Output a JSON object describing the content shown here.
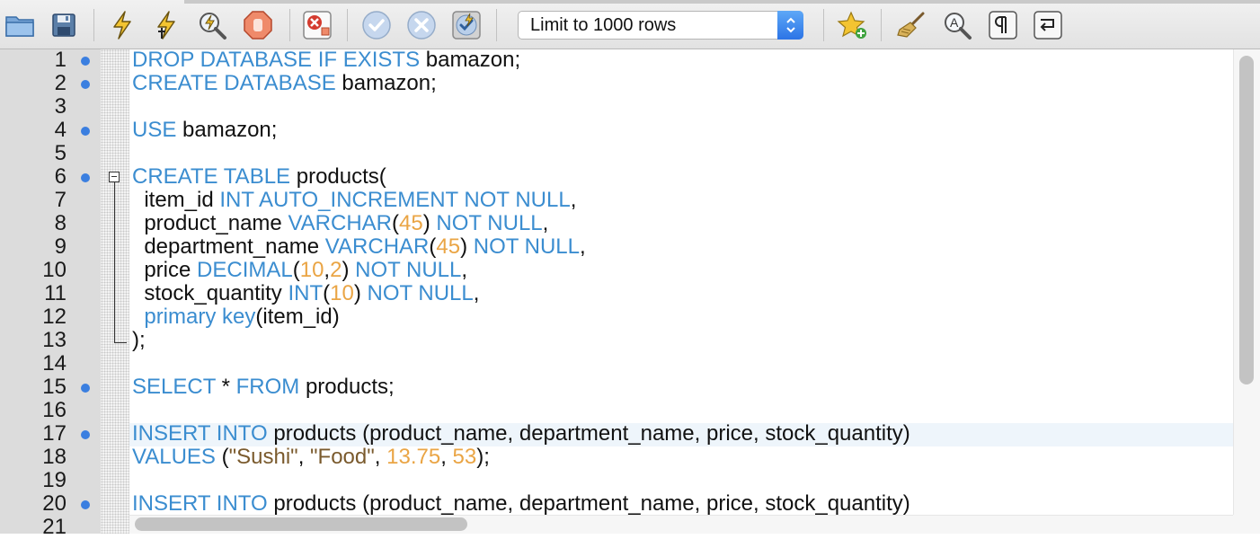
{
  "toolbar": {
    "buttons": [
      {
        "name": "open-folder",
        "icon": "folder-icon"
      },
      {
        "name": "save",
        "icon": "floppy-disk-icon"
      },
      {
        "name": "execute",
        "icon": "lightning-icon"
      },
      {
        "name": "execute-current",
        "icon": "lightning-cursor-icon"
      },
      {
        "name": "explain",
        "icon": "magnifier-lightning-icon"
      },
      {
        "name": "stop",
        "icon": "stop-hand-icon"
      },
      {
        "name": "toggle-error-stop",
        "icon": "error-stop-icon"
      },
      {
        "name": "commit",
        "icon": "check-circle-icon"
      },
      {
        "name": "rollback",
        "icon": "x-circle-icon"
      },
      {
        "name": "auto-commit",
        "icon": "auto-commit-icon"
      },
      {
        "name": "add-snippet",
        "icon": "star-plus-icon"
      },
      {
        "name": "beautify",
        "icon": "broom-icon"
      },
      {
        "name": "find",
        "icon": "find-icon"
      },
      {
        "name": "invisible-chars",
        "icon": "pilcrow-icon"
      },
      {
        "name": "wrap-lines",
        "icon": "wrap-icon"
      }
    ],
    "limit_select": {
      "value": "Limit to 1000 rows"
    }
  },
  "colors": {
    "keyword": "#3b8dd0",
    "number": "#eaa545",
    "string": "#7a5a2d",
    "marker": "#3b7fe0",
    "current_line": "#eef5fb"
  },
  "editor": {
    "lines": [
      {
        "n": "1",
        "marker": true,
        "tokens": [
          {
            "t": "kw",
            "v": "DROP DATABASE IF EXISTS"
          },
          {
            "t": "id",
            "v": " bamazon;"
          }
        ]
      },
      {
        "n": "2",
        "marker": true,
        "tokens": [
          {
            "t": "kw",
            "v": "CREATE DATABASE"
          },
          {
            "t": "id",
            "v": " bamazon;"
          }
        ]
      },
      {
        "n": "3",
        "marker": false,
        "tokens": []
      },
      {
        "n": "4",
        "marker": true,
        "tokens": [
          {
            "t": "kw",
            "v": "USE"
          },
          {
            "t": "id",
            "v": " bamazon;"
          }
        ]
      },
      {
        "n": "5",
        "marker": false,
        "tokens": []
      },
      {
        "n": "6",
        "marker": true,
        "tokens": [
          {
            "t": "kw",
            "v": "CREATE TABLE"
          },
          {
            "t": "id",
            "v": " products("
          }
        ]
      },
      {
        "n": "7",
        "marker": false,
        "tokens": [
          {
            "t": "id",
            "v": "  item_id "
          },
          {
            "t": "kw",
            "v": "INT AUTO_INCREMENT NOT NULL"
          },
          {
            "t": "id",
            "v": ","
          }
        ]
      },
      {
        "n": "8",
        "marker": false,
        "tokens": [
          {
            "t": "id",
            "v": "  product_name "
          },
          {
            "t": "kw",
            "v": "VARCHAR"
          },
          {
            "t": "id",
            "v": "("
          },
          {
            "t": "num",
            "v": "45"
          },
          {
            "t": "id",
            "v": ") "
          },
          {
            "t": "kw",
            "v": "NOT NULL"
          },
          {
            "t": "id",
            "v": ","
          }
        ]
      },
      {
        "n": "9",
        "marker": false,
        "tokens": [
          {
            "t": "id",
            "v": "  department_name "
          },
          {
            "t": "kw",
            "v": "VARCHAR"
          },
          {
            "t": "id",
            "v": "("
          },
          {
            "t": "num",
            "v": "45"
          },
          {
            "t": "id",
            "v": ") "
          },
          {
            "t": "kw",
            "v": "NOT NULL"
          },
          {
            "t": "id",
            "v": ","
          }
        ]
      },
      {
        "n": "10",
        "marker": false,
        "tokens": [
          {
            "t": "id",
            "v": "  price "
          },
          {
            "t": "kw",
            "v": "DECIMAL"
          },
          {
            "t": "id",
            "v": "("
          },
          {
            "t": "num",
            "v": "10"
          },
          {
            "t": "id",
            "v": ","
          },
          {
            "t": "num",
            "v": "2"
          },
          {
            "t": "id",
            "v": ") "
          },
          {
            "t": "kw",
            "v": "NOT NULL"
          },
          {
            "t": "id",
            "v": ","
          }
        ]
      },
      {
        "n": "11",
        "marker": false,
        "tokens": [
          {
            "t": "id",
            "v": "  stock_quantity "
          },
          {
            "t": "kw",
            "v": "INT"
          },
          {
            "t": "id",
            "v": "("
          },
          {
            "t": "num",
            "v": "10"
          },
          {
            "t": "id",
            "v": ") "
          },
          {
            "t": "kw",
            "v": "NOT NULL"
          },
          {
            "t": "id",
            "v": ","
          }
        ]
      },
      {
        "n": "12",
        "marker": false,
        "tokens": [
          {
            "t": "id",
            "v": "  "
          },
          {
            "t": "kw",
            "v": "primary key"
          },
          {
            "t": "id",
            "v": "(item_id)"
          }
        ]
      },
      {
        "n": "13",
        "marker": false,
        "tokens": [
          {
            "t": "id",
            "v": ");"
          }
        ]
      },
      {
        "n": "14",
        "marker": false,
        "tokens": []
      },
      {
        "n": "15",
        "marker": true,
        "tokens": [
          {
            "t": "kw",
            "v": "SELECT"
          },
          {
            "t": "id",
            "v": " * "
          },
          {
            "t": "kw",
            "v": "FROM"
          },
          {
            "t": "id",
            "v": " products;"
          }
        ]
      },
      {
        "n": "16",
        "marker": false,
        "tokens": []
      },
      {
        "n": "17",
        "marker": true,
        "current": true,
        "tokens": [
          {
            "t": "kw",
            "v": "INSERT INTO"
          },
          {
            "t": "id",
            "v": " products (product_name, department_name, price, stock_quantity)"
          }
        ]
      },
      {
        "n": "18",
        "marker": false,
        "tokens": [
          {
            "t": "kw",
            "v": "VALUES"
          },
          {
            "t": "id",
            "v": " ("
          },
          {
            "t": "str",
            "v": "\"Sushi\""
          },
          {
            "t": "id",
            "v": ", "
          },
          {
            "t": "str",
            "v": "\"Food\""
          },
          {
            "t": "id",
            "v": ", "
          },
          {
            "t": "num",
            "v": "13.75"
          },
          {
            "t": "id",
            "v": ", "
          },
          {
            "t": "num",
            "v": "53"
          },
          {
            "t": "id",
            "v": ");"
          }
        ]
      },
      {
        "n": "19",
        "marker": false,
        "tokens": []
      },
      {
        "n": "20",
        "marker": true,
        "tokens": [
          {
            "t": "kw",
            "v": "INSERT INTO"
          },
          {
            "t": "id",
            "v": " products (product_name, department_name, price, stock_quantity)"
          }
        ]
      },
      {
        "n": "21",
        "marker": false,
        "tokens": []
      }
    ]
  }
}
